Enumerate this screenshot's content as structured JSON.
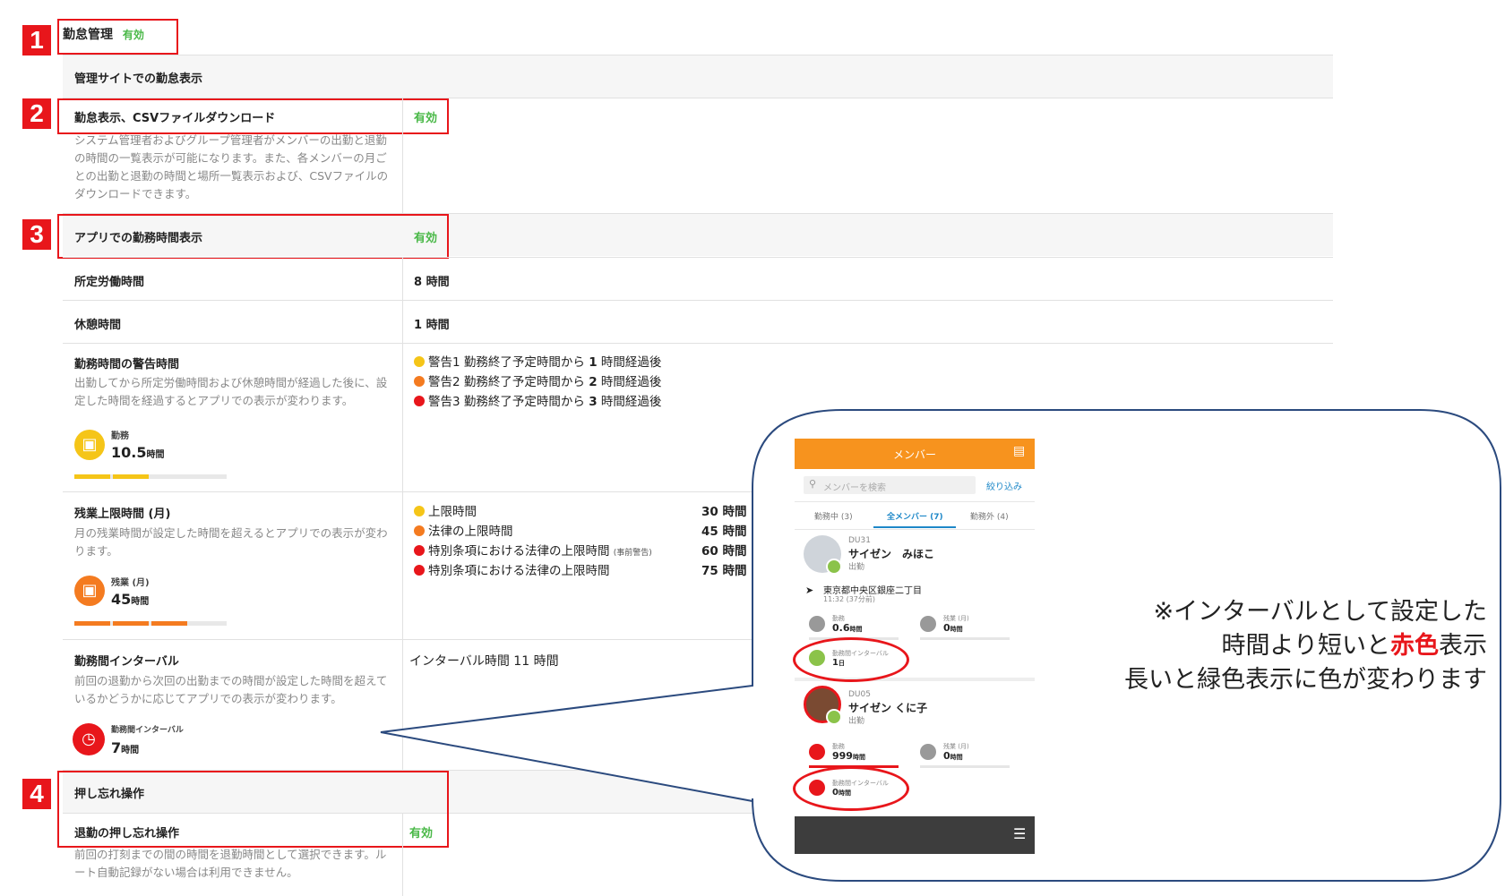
{
  "badges": [
    "1",
    "2",
    "3",
    "4"
  ],
  "section1": {
    "title": "勤怠管理",
    "status": "有効"
  },
  "admin_header": "管理サイトでの勤怠表示",
  "csv": {
    "label": "勤怠表示、CSVファイルダウンロード",
    "status": "有効",
    "desc": "システム管理者およびグループ管理者がメンバーの出勤と退勤の時間の一覧表示が可能になります。また、各メンバーの月ごとの出勤と退勤の時間と場所一覧表示および、CSVファイルのダウンロードできます。"
  },
  "app": {
    "label": "アプリでの勤務時間表示",
    "status": "有効"
  },
  "scheduled": {
    "label": "所定労働時間",
    "value": "8 時間"
  },
  "break": {
    "label": "休憩時間",
    "value": "1 時間"
  },
  "warning": {
    "label": "勤務時間の警告時間",
    "desc": "出勤してから所定労働時間および休憩時間が経過した後に、設定した時間を経過するとアプリでの表示が変わります。",
    "icon_label": "勤務",
    "icon_value": "10.5",
    "icon_unit": "時間",
    "items": [
      {
        "name": "警告1",
        "text": "勤務終了予定時間から",
        "num": "1",
        "suffix": "時間経過後",
        "color": "#f5c518"
      },
      {
        "name": "警告2",
        "text": "勤務終了予定時間から",
        "num": "2",
        "suffix": "時間経過後",
        "color": "#f47b20"
      },
      {
        "name": "警告3",
        "text": "勤務終了予定時間から",
        "num": "3",
        "suffix": "時間経過後",
        "color": "#e8161b"
      }
    ]
  },
  "overtime": {
    "label": "残業上限時間 (月)",
    "desc": "月の残業時間が設定した時間を超えるとアプリでの表示が変わります。",
    "icon_label": "残業 (月)",
    "icon_value": "45",
    "icon_unit": "時間",
    "items": [
      {
        "text": "上限時間",
        "small": "",
        "hours": "30 時間",
        "color": "#f5c518"
      },
      {
        "text": "法律の上限時間",
        "small": "",
        "hours": "45 時間",
        "color": "#f47b20"
      },
      {
        "text": "特別条項における法律の上限時間",
        "small": "(事前警告)",
        "hours": "60 時間",
        "color": "#e8161b"
      },
      {
        "text": "特別条項における法律の上限時間",
        "small": "",
        "hours": "75 時間",
        "color": "#e8161b"
      }
    ]
  },
  "interval": {
    "label": "勤務間インターバル",
    "desc": "前回の退勤から次回の出勤までの時間が設定した時間を超えているかどうかに応じてアプリでの表示が変わります。",
    "icon_label": "勤務間インターバル",
    "icon_value": "7",
    "icon_unit": "時間",
    "value": "インターバル時間 11 時間"
  },
  "push": {
    "header": "押し忘れ操作",
    "label": "退勤の押し忘れ操作",
    "status": "有効",
    "desc": "前回の打刻までの間の時間を退勤時間として選択できます。ルート自動記録がない場合は利用できません。"
  },
  "phone": {
    "title": "メンバー",
    "search_placeholder": "メンバーを検索",
    "filter": "絞り込み",
    "tabs": [
      "勤務中 (3)",
      "全メンバー (7)",
      "勤務外 (4)"
    ],
    "member1": {
      "id": "DU31",
      "name": "サイゼン　みほこ",
      "status": "出勤",
      "location": "東京都中央区銀座二丁目",
      "time": "11:32 (37分前)",
      "work_label": "勤務",
      "work_value": "0.6",
      "work_unit": "時間",
      "ot_label": "残業 (月)",
      "ot_value": "0",
      "ot_unit": "時間",
      "int_label": "勤務間インターバル",
      "int_value": "1",
      "int_unit": "日"
    },
    "member2": {
      "id": "DU05",
      "name": "サイゼン くに子",
      "status": "出勤",
      "work_label": "勤務",
      "work_value": "999",
      "work_unit": "時間",
      "ot_label": "残業 (月)",
      "ot_value": "0",
      "ot_unit": "時間",
      "int_label": "勤務間インターバル",
      "int_value": "0",
      "int_unit": "時間"
    }
  },
  "note": {
    "line1": "※インターバルとして設定した",
    "line2a": "時間より短いと",
    "line2b": "赤色",
    "line2c": "表示",
    "line3": "長いと緑色表示に色が変わります"
  },
  "colors": {
    "red": "#e8161b",
    "green": "#49b847",
    "orange": "#f47b20",
    "yellow": "#f5c518",
    "navy": "#2b4a7e"
  }
}
